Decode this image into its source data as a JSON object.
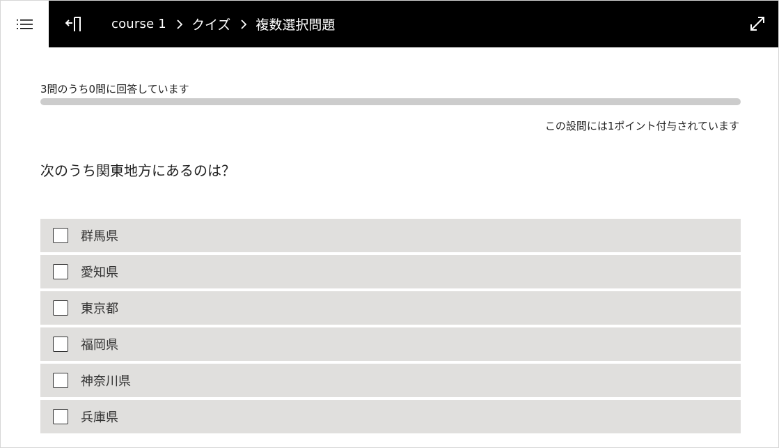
{
  "header": {
    "menu_icon": "list-menu-icon",
    "exit_icon": "exit-door-icon",
    "expand_icon": "expand-arrows-icon",
    "breadcrumb": {
      "course": "course 1",
      "section": "クイズ",
      "page": "複数選択問題"
    }
  },
  "progress": {
    "text": "3問のうち0問に回答しています",
    "answered": 0,
    "total": 3
  },
  "points_text": "この設問には1ポイント付与されています",
  "question": "次のうち関東地方にあるのは？",
  "options": [
    {
      "label": "群馬県",
      "checked": false
    },
    {
      "label": "愛知県",
      "checked": false
    },
    {
      "label": "東京都",
      "checked": false
    },
    {
      "label": "福岡県",
      "checked": false
    },
    {
      "label": "神奈川県",
      "checked": false
    },
    {
      "label": "兵庫県",
      "checked": false
    }
  ],
  "colors": {
    "topbar": "#000000",
    "option_bg": "#e0dfdd",
    "progress_track": "#cccccc"
  }
}
